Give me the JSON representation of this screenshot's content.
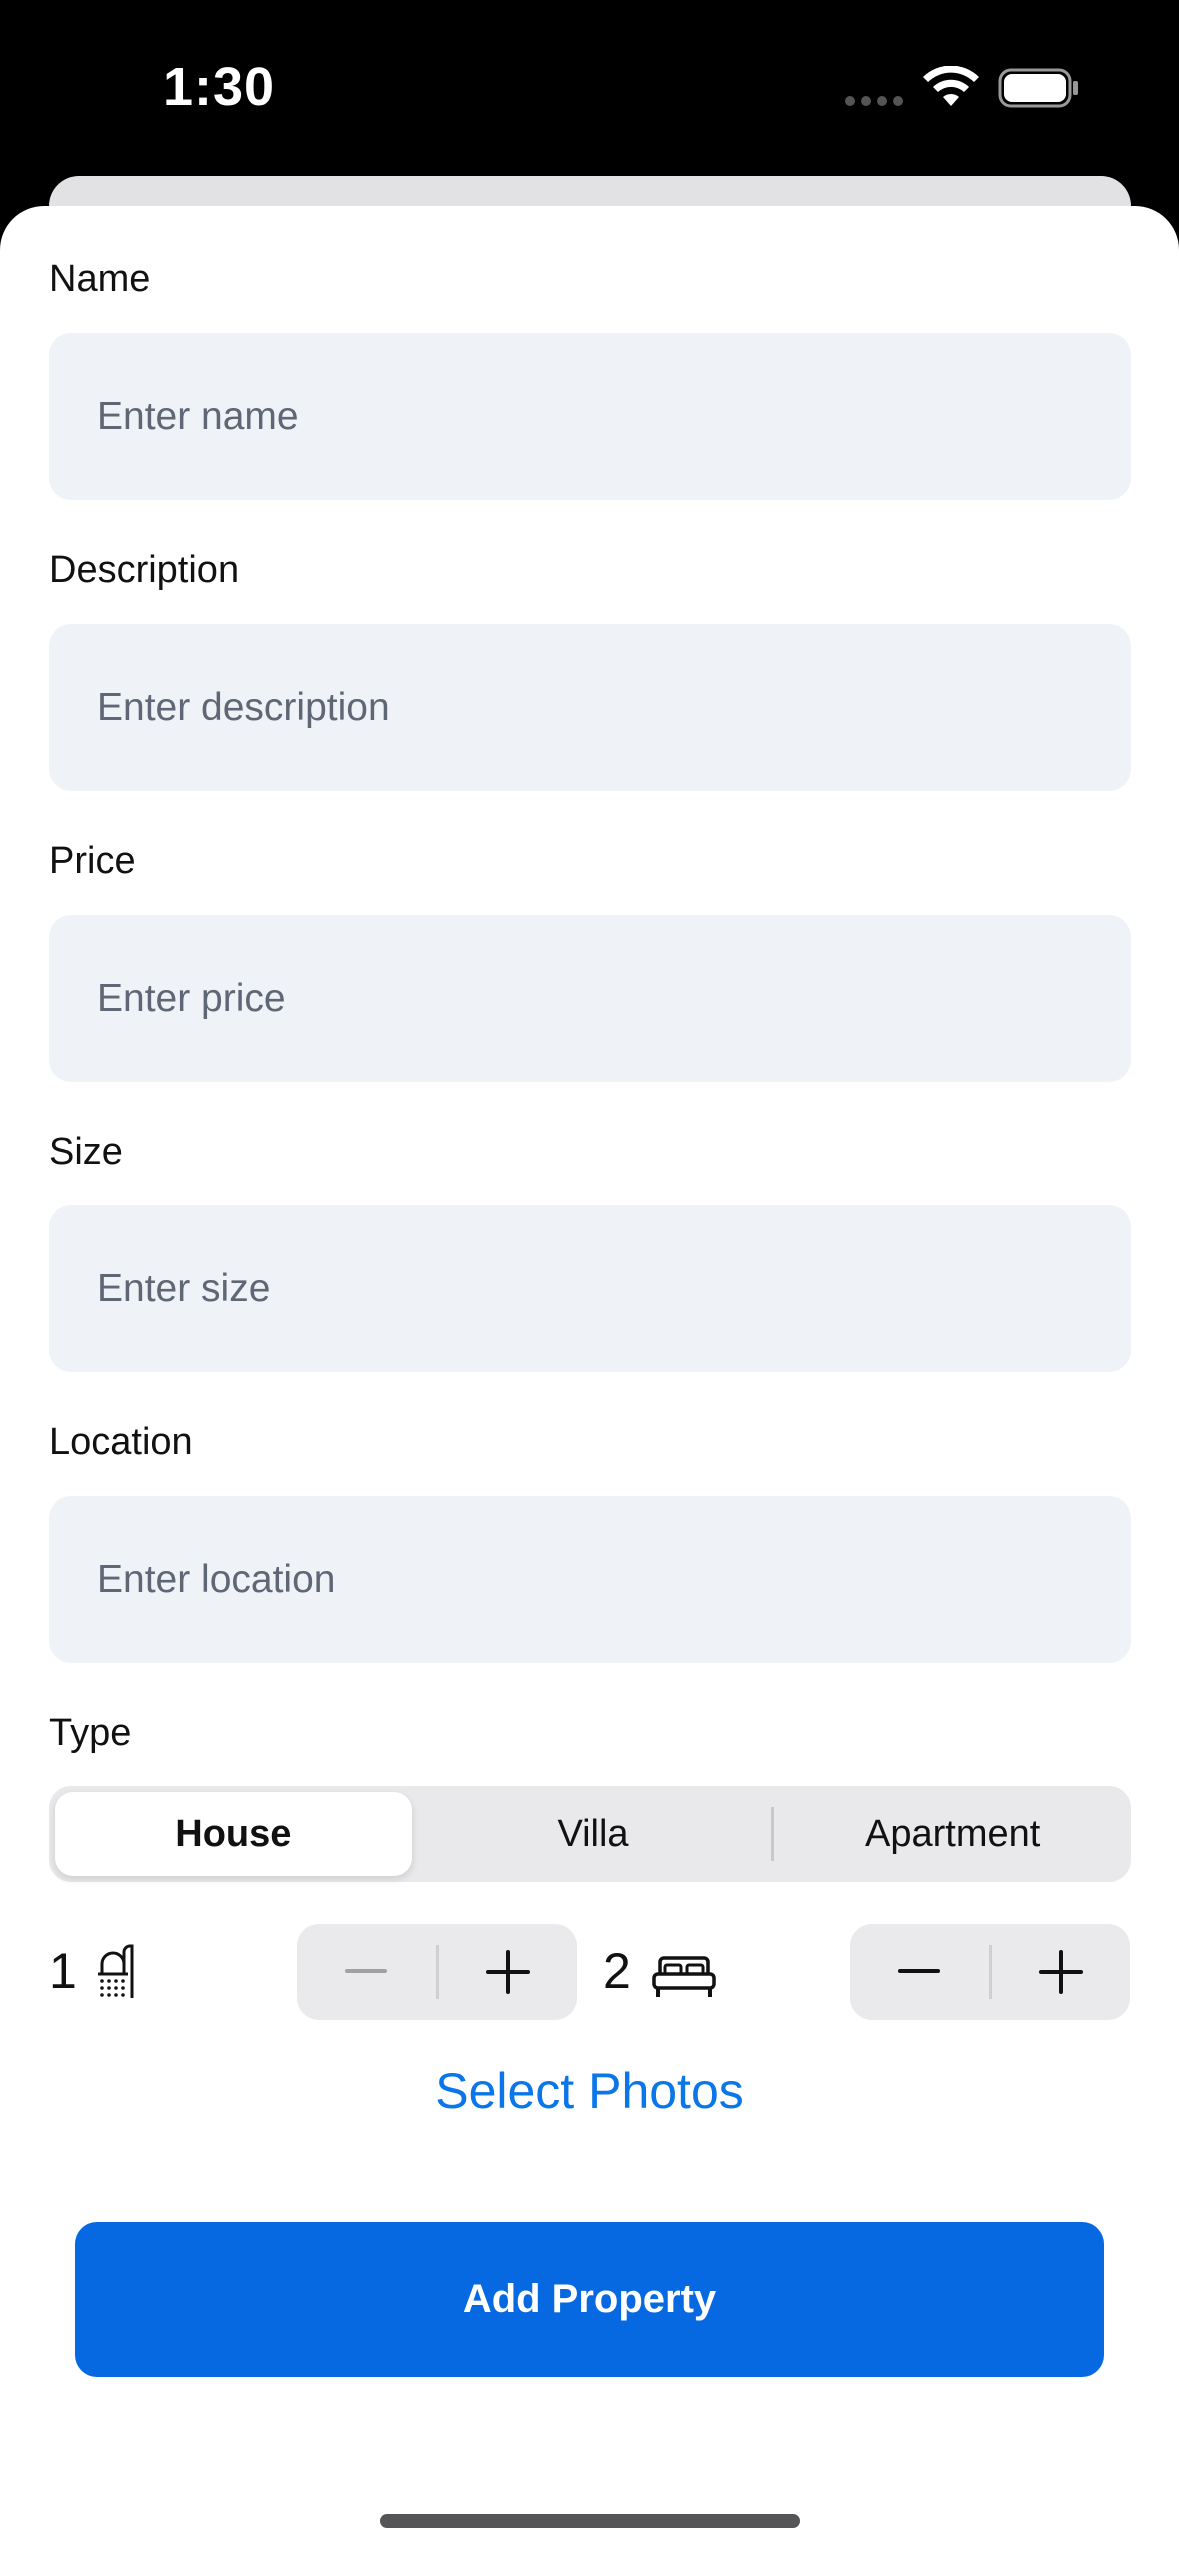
{
  "status_bar": {
    "time": "1:30"
  },
  "form": {
    "fields": [
      {
        "label": "Name",
        "placeholder": "Enter name",
        "value": ""
      },
      {
        "label": "Description",
        "placeholder": "Enter description",
        "value": ""
      },
      {
        "label": "Price",
        "placeholder": "Enter price",
        "value": ""
      },
      {
        "label": "Size",
        "placeholder": "Enter size",
        "value": ""
      },
      {
        "label": "Location",
        "placeholder": "Enter location",
        "value": ""
      }
    ],
    "type": {
      "label": "Type",
      "options": [
        "House",
        "Villa",
        "Apartment"
      ],
      "selected": "House"
    },
    "bathrooms": {
      "count": "1",
      "icon": "shower-icon"
    },
    "bedrooms": {
      "count": "2",
      "icon": "bed-icon"
    },
    "select_photos": "Select Photos",
    "submit": "Add Property"
  },
  "colors": {
    "accent": "#0669E1",
    "link": "#0A76E8",
    "input_bg": "#EFF2F7"
  }
}
